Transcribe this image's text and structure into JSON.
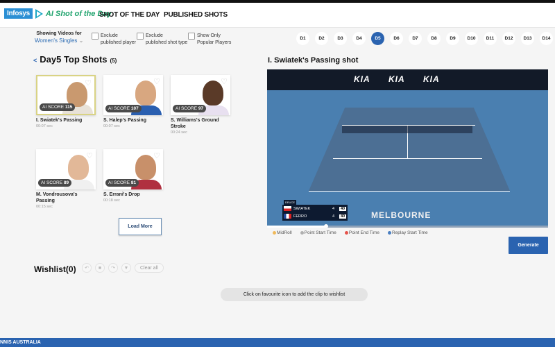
{
  "header": {
    "logo_brand": "Infosys",
    "logo_title": "AI Shot of the Day",
    "tabs": [
      {
        "label": "SHOT OF THE DAY",
        "active": true
      },
      {
        "label": "PUBLISHED SHOTS",
        "active": false
      }
    ]
  },
  "filters": {
    "showing_label": "Showing Videos for",
    "category_value": "Women's Singles",
    "checkboxes": [
      {
        "label_line1": "Exclude",
        "label_line2": "published player",
        "checked": false
      },
      {
        "label_line1": "Exclude",
        "label_line2": "published shot type",
        "checked": false
      },
      {
        "label_line1": "Show Only",
        "label_line2": "Popular Players",
        "checked": false
      }
    ]
  },
  "days": [
    "D1",
    "D2",
    "D3",
    "D4",
    "D5",
    "D6",
    "D7",
    "D8",
    "D9",
    "D10",
    "D11",
    "D12",
    "D13",
    "D14"
  ],
  "active_day": "D5",
  "shots_section": {
    "back_icon": "<",
    "title": "Day5 Top Shots",
    "count": "(5)",
    "score_label": "AI SCORE",
    "cards": [
      {
        "name": "I. Swiatek's Passing",
        "duration": "00:07 sec",
        "score": "115",
        "selected": true
      },
      {
        "name": "S. Halep's Passing",
        "duration": "00:07 sec",
        "score": "107",
        "selected": false
      },
      {
        "name": "S. Williams's Ground Stroke",
        "duration": "00:24 sec",
        "score": "97",
        "selected": false
      },
      {
        "name": "M. Vondrousova's Passing",
        "duration": "00:15 sec",
        "score": "89",
        "selected": false
      },
      {
        "name": "S. Errani's Drop",
        "duration": "00:18 sec",
        "score": "81",
        "selected": false
      }
    ],
    "load_more_label": "Load More"
  },
  "video": {
    "title": "I. Swiatek's Passing shot",
    "sponsor": "KIA",
    "venue_text": "MELBOURNE",
    "scoreboard": {
      "status": "DEUCE",
      "players": [
        {
          "name": "SWIATEK",
          "games": "4",
          "points": "40"
        },
        {
          "name": "FERRO",
          "games": "4",
          "points": "40"
        }
      ]
    },
    "progress_fraction": 0.21,
    "legend": [
      {
        "label": "MidRoll",
        "color": "#f0b95a"
      },
      {
        "label": "Point Start Time",
        "color": "#b0b0b0"
      },
      {
        "label": "Point End Time",
        "color": "#e5534b"
      },
      {
        "label": "Replay Start Time",
        "color": "#4a7fc1"
      }
    ],
    "generate_label": "Generate"
  },
  "wishlist": {
    "title": "Wishlist(0)",
    "clear_all_label": "Clear all",
    "hint": "Click on favourite icon to add the clip to wishlist"
  },
  "footer": {
    "text": "NNIS AUSTRALIA"
  }
}
